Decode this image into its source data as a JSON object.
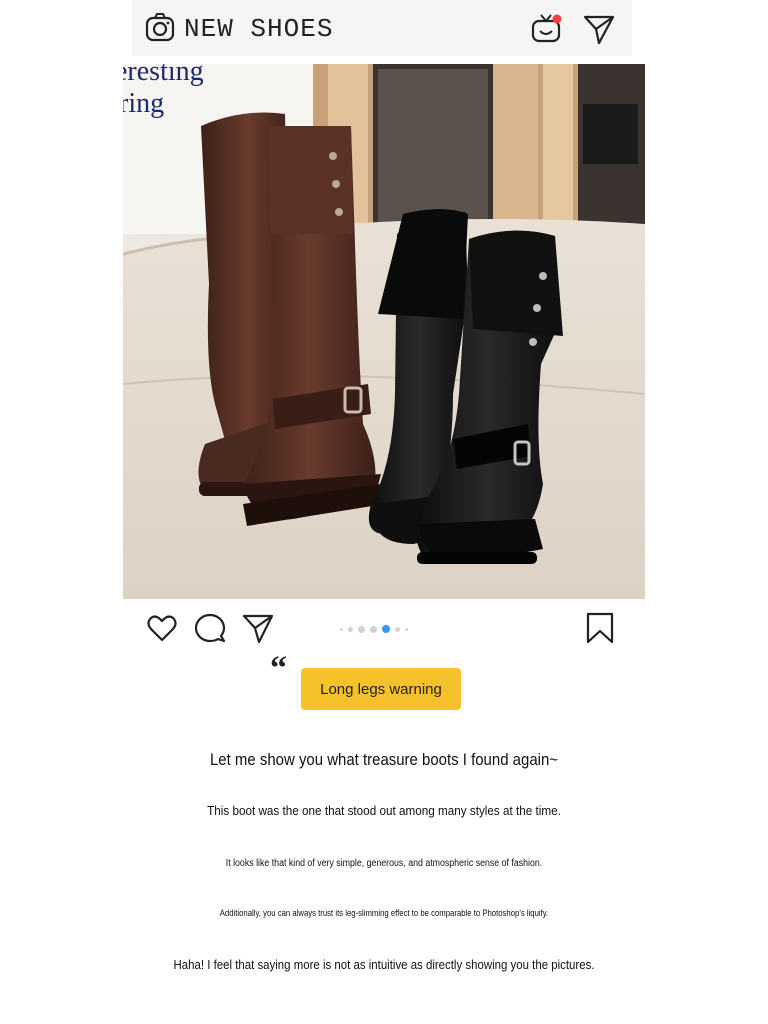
{
  "header": {
    "brand": "NEW SHOES",
    "icons": [
      "camera-icon",
      "tv-icon",
      "send-icon"
    ],
    "notification_color": "#f04040"
  },
  "post": {
    "image_background_text": [
      "eresting",
      "ring"
    ],
    "carousel": {
      "total": 7,
      "active_index": 4,
      "active_color": "#3897f0"
    }
  },
  "actions": {
    "icons": [
      "heart-icon",
      "comment-icon",
      "share-icon",
      "bookmark-icon"
    ]
  },
  "caption": {
    "tag": "Long legs warning",
    "tag_color": "#f6c22b",
    "lines": [
      "Let me show you what treasure boots I found again~",
      "This boot was the one that stood out among many styles at the time.",
      "It looks like that kind of very simple, generous, and atmospheric sense of fashion.",
      "Additionally, you can always trust its leg-slimming effect to be comparable to Photoshop's liquify.",
      "Haha! I feel that saying more is not as intuitive as directly showing you the pictures."
    ]
  }
}
